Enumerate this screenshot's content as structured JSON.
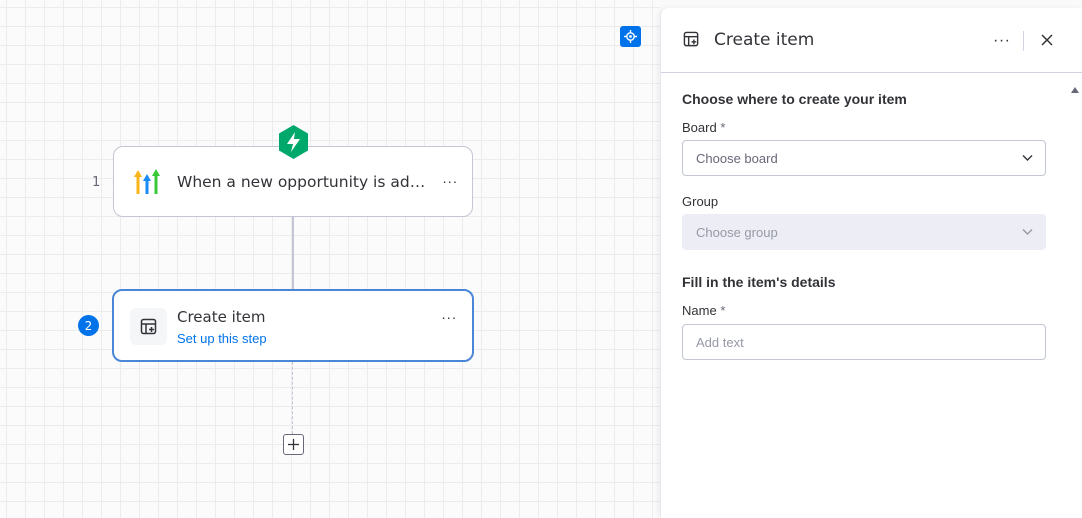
{
  "canvas": {
    "steps": [
      {
        "number": "1",
        "title": "When a new opportunity is added",
        "more": "···"
      },
      {
        "number": "2",
        "title": "Create item",
        "subtitle": "Set up this step",
        "more": "···"
      }
    ],
    "add_step_icon": "plus-icon",
    "recenter_icon": "crosshair-icon"
  },
  "panel": {
    "title": "Create item",
    "more": "···",
    "sections": {
      "where_title": "Choose where to create your item",
      "board_label": "Board",
      "board_required": "*",
      "board_placeholder": "Choose board",
      "group_label": "Group",
      "group_placeholder": "Choose group",
      "details_title": "Fill in the item's details",
      "name_label": "Name",
      "name_required": "*",
      "name_placeholder": "Add text"
    }
  },
  "colors": {
    "accent": "#0073ea",
    "trigger_badge": "#00a86b",
    "text_primary": "#323338",
    "text_secondary": "#676879"
  }
}
